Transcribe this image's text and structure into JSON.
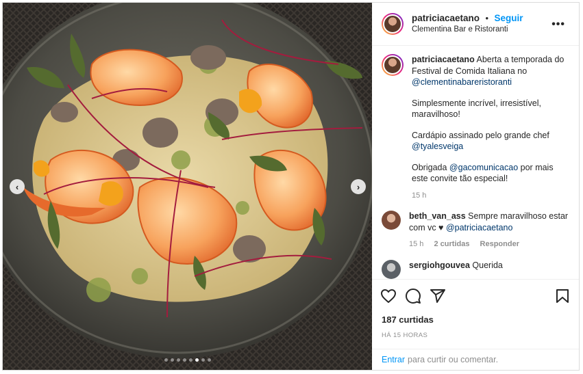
{
  "post": {
    "author": "patriciacaetano",
    "follow_label": "Seguir",
    "bullet": "•",
    "location": "Clementina Bar e Ristoranti",
    "more": "•••",
    "caption": {
      "username": "patriciacaetano",
      "line1": "Aberta a temporada do Festival de Comida Italiana no",
      "mention1": "@clementinabareristoranti",
      "p2": "Simplesmente incrível, irresistível, maravilhoso!",
      "p3": "Cardápio assinado pelo grande chef",
      "mention2": "@tyalesveiga",
      "p4a": "Obrigada",
      "mention3": "@gacomunicacao",
      "p4b": "por mais este convite tão especial!",
      "time": "15 h"
    },
    "comments": [
      {
        "username": "beth_van_ass",
        "text": "Sempre maravilhoso estar com vc ♥",
        "mention": "@patriciacaetano",
        "time": "15 h",
        "likes": "2 curtidas",
        "reply": "Responder"
      },
      {
        "username": "sergiohgouvea",
        "text": "Querida"
      }
    ],
    "likes": "187 curtidas",
    "posted": "HÁ 15 HORAS",
    "add_comment": {
      "login": "Entrar",
      "text": "para curtir ou comentar."
    },
    "carousel": {
      "prev": "‹",
      "next": "›",
      "total": 8,
      "active": 6
    }
  },
  "icons": {
    "like": "heart-icon",
    "comment": "comment-bubble-icon",
    "share": "paper-plane-icon",
    "save": "bookmark-icon"
  }
}
